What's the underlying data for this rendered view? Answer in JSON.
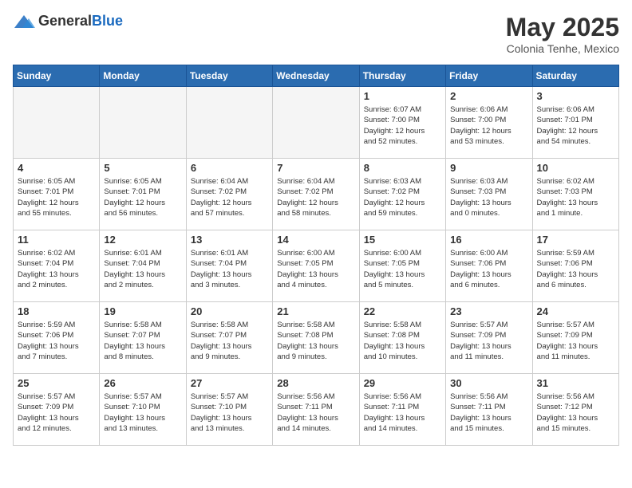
{
  "header": {
    "logo_general": "General",
    "logo_blue": "Blue",
    "title": "May 2025",
    "subtitle": "Colonia Tenhe, Mexico"
  },
  "weekdays": [
    "Sunday",
    "Monday",
    "Tuesday",
    "Wednesday",
    "Thursday",
    "Friday",
    "Saturday"
  ],
  "weeks": [
    [
      {
        "day": "",
        "info": "",
        "empty": true
      },
      {
        "day": "",
        "info": "",
        "empty": true
      },
      {
        "day": "",
        "info": "",
        "empty": true
      },
      {
        "day": "",
        "info": "",
        "empty": true
      },
      {
        "day": "1",
        "info": "Sunrise: 6:07 AM\nSunset: 7:00 PM\nDaylight: 12 hours\nand 52 minutes.",
        "empty": false
      },
      {
        "day": "2",
        "info": "Sunrise: 6:06 AM\nSunset: 7:00 PM\nDaylight: 12 hours\nand 53 minutes.",
        "empty": false
      },
      {
        "day": "3",
        "info": "Sunrise: 6:06 AM\nSunset: 7:01 PM\nDaylight: 12 hours\nand 54 minutes.",
        "empty": false
      }
    ],
    [
      {
        "day": "4",
        "info": "Sunrise: 6:05 AM\nSunset: 7:01 PM\nDaylight: 12 hours\nand 55 minutes.",
        "empty": false
      },
      {
        "day": "5",
        "info": "Sunrise: 6:05 AM\nSunset: 7:01 PM\nDaylight: 12 hours\nand 56 minutes.",
        "empty": false
      },
      {
        "day": "6",
        "info": "Sunrise: 6:04 AM\nSunset: 7:02 PM\nDaylight: 12 hours\nand 57 minutes.",
        "empty": false
      },
      {
        "day": "7",
        "info": "Sunrise: 6:04 AM\nSunset: 7:02 PM\nDaylight: 12 hours\nand 58 minutes.",
        "empty": false
      },
      {
        "day": "8",
        "info": "Sunrise: 6:03 AM\nSunset: 7:02 PM\nDaylight: 12 hours\nand 59 minutes.",
        "empty": false
      },
      {
        "day": "9",
        "info": "Sunrise: 6:03 AM\nSunset: 7:03 PM\nDaylight: 13 hours\nand 0 minutes.",
        "empty": false
      },
      {
        "day": "10",
        "info": "Sunrise: 6:02 AM\nSunset: 7:03 PM\nDaylight: 13 hours\nand 1 minute.",
        "empty": false
      }
    ],
    [
      {
        "day": "11",
        "info": "Sunrise: 6:02 AM\nSunset: 7:04 PM\nDaylight: 13 hours\nand 2 minutes.",
        "empty": false
      },
      {
        "day": "12",
        "info": "Sunrise: 6:01 AM\nSunset: 7:04 PM\nDaylight: 13 hours\nand 2 minutes.",
        "empty": false
      },
      {
        "day": "13",
        "info": "Sunrise: 6:01 AM\nSunset: 7:04 PM\nDaylight: 13 hours\nand 3 minutes.",
        "empty": false
      },
      {
        "day": "14",
        "info": "Sunrise: 6:00 AM\nSunset: 7:05 PM\nDaylight: 13 hours\nand 4 minutes.",
        "empty": false
      },
      {
        "day": "15",
        "info": "Sunrise: 6:00 AM\nSunset: 7:05 PM\nDaylight: 13 hours\nand 5 minutes.",
        "empty": false
      },
      {
        "day": "16",
        "info": "Sunrise: 6:00 AM\nSunset: 7:06 PM\nDaylight: 13 hours\nand 6 minutes.",
        "empty": false
      },
      {
        "day": "17",
        "info": "Sunrise: 5:59 AM\nSunset: 7:06 PM\nDaylight: 13 hours\nand 6 minutes.",
        "empty": false
      }
    ],
    [
      {
        "day": "18",
        "info": "Sunrise: 5:59 AM\nSunset: 7:06 PM\nDaylight: 13 hours\nand 7 minutes.",
        "empty": false
      },
      {
        "day": "19",
        "info": "Sunrise: 5:58 AM\nSunset: 7:07 PM\nDaylight: 13 hours\nand 8 minutes.",
        "empty": false
      },
      {
        "day": "20",
        "info": "Sunrise: 5:58 AM\nSunset: 7:07 PM\nDaylight: 13 hours\nand 9 minutes.",
        "empty": false
      },
      {
        "day": "21",
        "info": "Sunrise: 5:58 AM\nSunset: 7:08 PM\nDaylight: 13 hours\nand 9 minutes.",
        "empty": false
      },
      {
        "day": "22",
        "info": "Sunrise: 5:58 AM\nSunset: 7:08 PM\nDaylight: 13 hours\nand 10 minutes.",
        "empty": false
      },
      {
        "day": "23",
        "info": "Sunrise: 5:57 AM\nSunset: 7:09 PM\nDaylight: 13 hours\nand 11 minutes.",
        "empty": false
      },
      {
        "day": "24",
        "info": "Sunrise: 5:57 AM\nSunset: 7:09 PM\nDaylight: 13 hours\nand 11 minutes.",
        "empty": false
      }
    ],
    [
      {
        "day": "25",
        "info": "Sunrise: 5:57 AM\nSunset: 7:09 PM\nDaylight: 13 hours\nand 12 minutes.",
        "empty": false
      },
      {
        "day": "26",
        "info": "Sunrise: 5:57 AM\nSunset: 7:10 PM\nDaylight: 13 hours\nand 13 minutes.",
        "empty": false
      },
      {
        "day": "27",
        "info": "Sunrise: 5:57 AM\nSunset: 7:10 PM\nDaylight: 13 hours\nand 13 minutes.",
        "empty": false
      },
      {
        "day": "28",
        "info": "Sunrise: 5:56 AM\nSunset: 7:11 PM\nDaylight: 13 hours\nand 14 minutes.",
        "empty": false
      },
      {
        "day": "29",
        "info": "Sunrise: 5:56 AM\nSunset: 7:11 PM\nDaylight: 13 hours\nand 14 minutes.",
        "empty": false
      },
      {
        "day": "30",
        "info": "Sunrise: 5:56 AM\nSunset: 7:11 PM\nDaylight: 13 hours\nand 15 minutes.",
        "empty": false
      },
      {
        "day": "31",
        "info": "Sunrise: 5:56 AM\nSunset: 7:12 PM\nDaylight: 13 hours\nand 15 minutes.",
        "empty": false
      }
    ]
  ]
}
